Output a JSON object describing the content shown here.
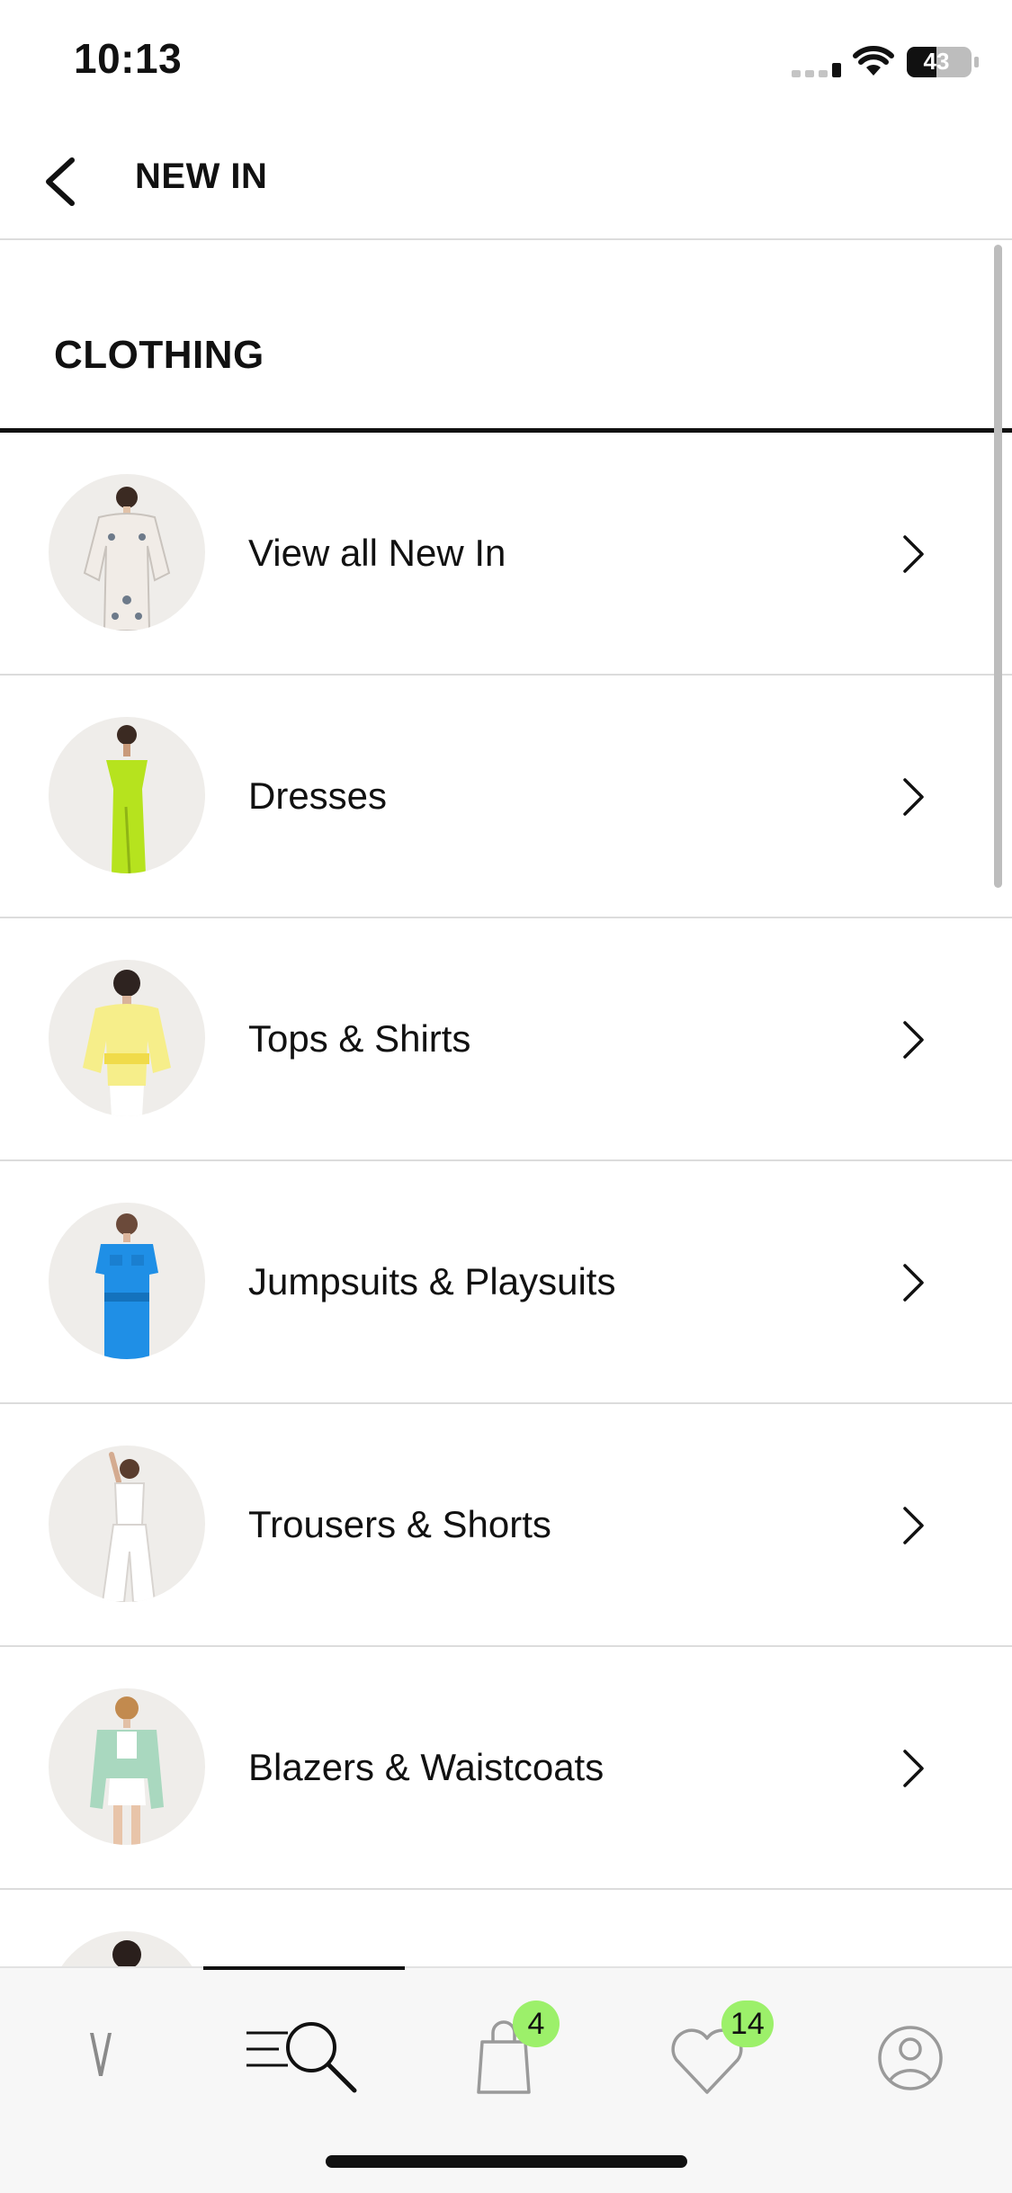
{
  "status_bar": {
    "time": "10:13",
    "battery": "43"
  },
  "header": {
    "title": "NEW IN"
  },
  "section": {
    "title": "CLOTHING"
  },
  "items": [
    {
      "label": "View all New In"
    },
    {
      "label": "Dresses"
    },
    {
      "label": "Tops & Shirts"
    },
    {
      "label": "Jumpsuits & Playsuits"
    },
    {
      "label": "Trousers & Shorts"
    },
    {
      "label": "Blazers & Waistcoats"
    },
    {
      "label": ""
    }
  ],
  "tab_bar": {
    "bag_count": "4",
    "wishlist_count": "14"
  },
  "colors": {
    "badge": "#9cf06a",
    "accent": "#111111"
  }
}
